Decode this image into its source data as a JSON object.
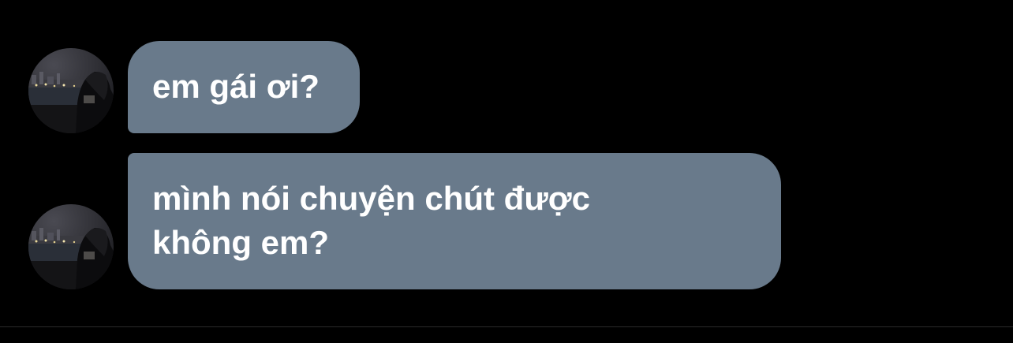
{
  "messages": [
    {
      "sender_avatar_icon": "contact-avatar-photo-icon",
      "lines": [
        "em gái ơi?"
      ]
    },
    {
      "sender_avatar_icon": "contact-avatar-photo-icon",
      "lines": [
        "mình nói chuyện chút được",
        "không em?"
      ]
    }
  ],
  "colors": {
    "background": "#000000",
    "incoming_bubble": "#697a8b",
    "bubble_text": "#ffffff",
    "divider": "#2a2a2a"
  }
}
